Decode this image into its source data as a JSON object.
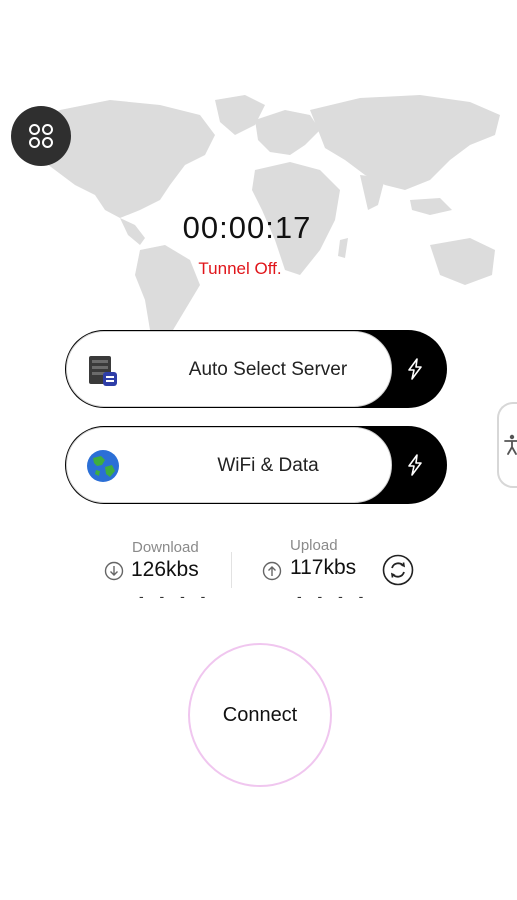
{
  "header": {
    "menu_icon": "grid-icon"
  },
  "status": {
    "timer": "00:00:17",
    "tunnel": "Tunnel Off."
  },
  "server_selector": {
    "label": "Auto Select Server",
    "icon": "server-icon",
    "action_icon": "bolt-icon"
  },
  "network_selector": {
    "label": "WiFi & Data",
    "icon": "globe-icon",
    "action_icon": "bolt-icon"
  },
  "stats": {
    "download": {
      "label": "Download",
      "value": "126kbs",
      "placeholder": "- - - -"
    },
    "upload": {
      "label": "Upload",
      "value": "117kbs",
      "placeholder": "- - - -"
    },
    "refresh_icon": "refresh-icon"
  },
  "connect": {
    "label": "Connect"
  },
  "accessibility": {
    "icon": "accessibility-icon"
  },
  "colors": {
    "status_red": "#e0151a",
    "connect_ring": "#f0c6ef",
    "pill_dark": "#000000",
    "map_gray": "#dedede"
  }
}
